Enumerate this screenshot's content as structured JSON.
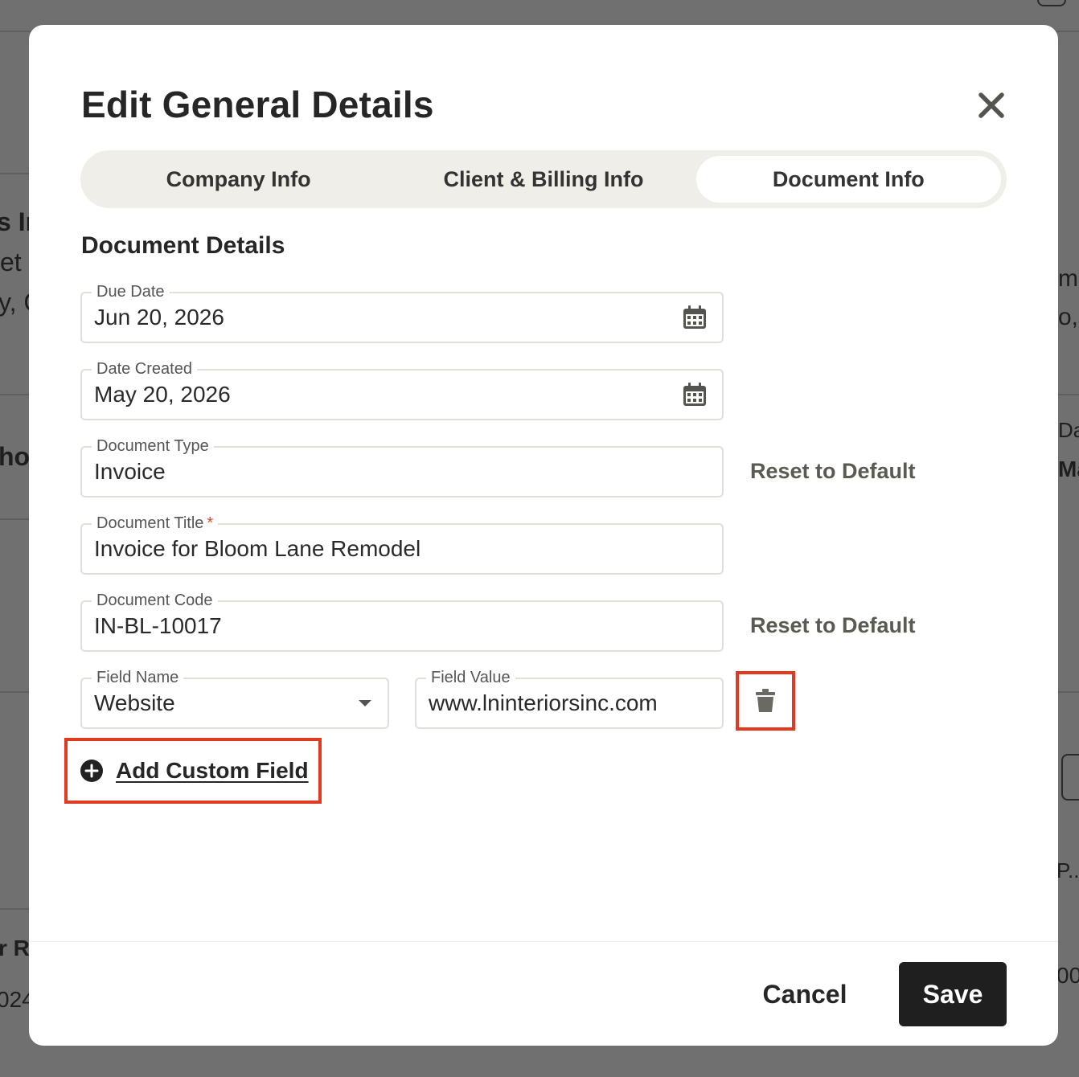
{
  "background": {
    "fragments": [
      "s In",
      "et",
      "y, C",
      "hoo",
      "r R",
      "024",
      "mi",
      "o,",
      "Da",
      "Ma",
      "P...",
      "00"
    ]
  },
  "modal": {
    "title": "Edit General Details",
    "close_icon": "close-icon",
    "tabs": [
      {
        "label": "Company Info",
        "active": false
      },
      {
        "label": "Client & Billing Info",
        "active": false
      },
      {
        "label": "Document Info",
        "active": true
      }
    ],
    "section_title": "Document Details",
    "fields": {
      "due_date": {
        "label": "Due Date",
        "value": "Jun 20, 2026",
        "icon": "calendar-icon"
      },
      "date_created": {
        "label": "Date Created",
        "value": "May 20, 2026",
        "icon": "calendar-icon"
      },
      "document_type": {
        "label": "Document Type",
        "value": "Invoice",
        "reset_label": "Reset to Default"
      },
      "document_title": {
        "label": "Document Title",
        "required_mark": "*",
        "value": "Invoice for Bloom Lane Remodel"
      },
      "document_code": {
        "label": "Document Code",
        "value": "IN-BL-10017",
        "reset_label": "Reset to Default"
      }
    },
    "custom_field": {
      "name_label": "Field Name",
      "name_value": "Website",
      "value_label": "Field Value",
      "value_value": "www.lninteriorsinc.com",
      "delete_icon": "trash-icon"
    },
    "add_custom_field_label": "Add Custom Field",
    "footer": {
      "cancel_label": "Cancel",
      "save_label": "Save"
    },
    "colors": {
      "highlight": "#e23a20",
      "save_bg": "#1f1f1f",
      "tab_track": "#efeee9",
      "required": "#d8482f"
    }
  }
}
